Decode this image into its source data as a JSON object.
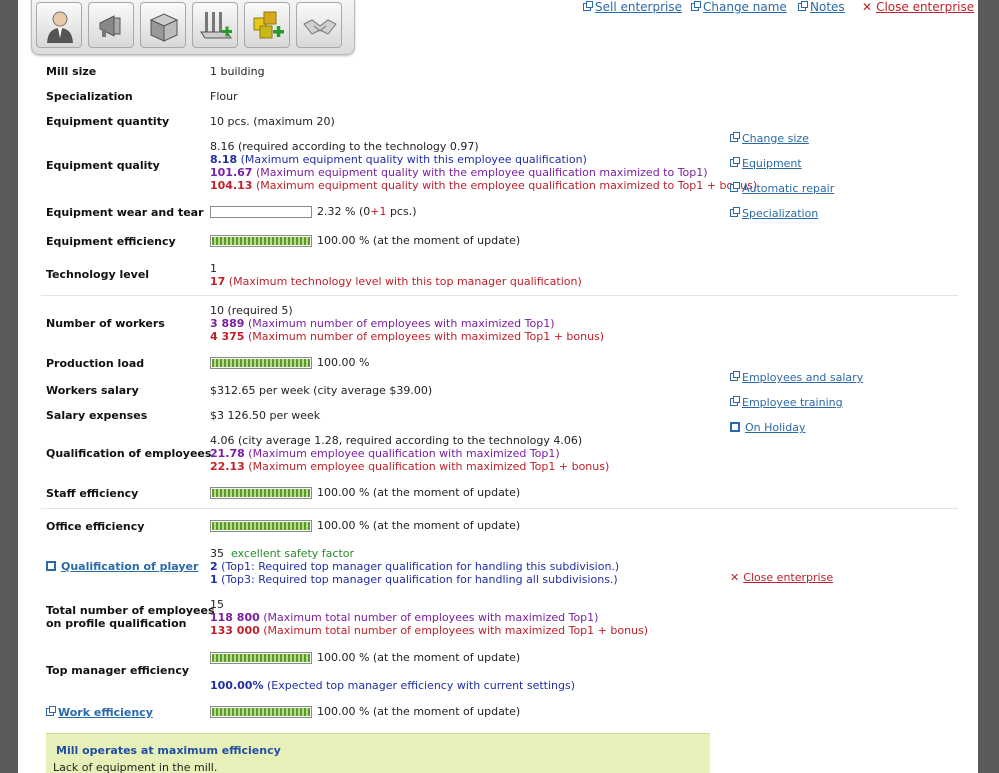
{
  "toolbar": {
    "buttons": [
      {
        "icon": "manager-icon"
      },
      {
        "icon": "megaphone-icon"
      },
      {
        "icon": "box-icon"
      },
      {
        "icon": "production-add-icon"
      },
      {
        "icon": "cubes-add-icon"
      },
      {
        "icon": "handshake-icon"
      }
    ]
  },
  "top_links": {
    "sell": "Sell enterprise",
    "change_name": "Change name",
    "notes": "Notes",
    "close": "Close enterprise"
  },
  "rows": {
    "mill_size": {
      "label": "Mill size",
      "value": "1 building"
    },
    "specialization": {
      "label": "Specialization",
      "value": "Flour"
    },
    "equipment_quantity": {
      "label": "Equipment quantity",
      "value": "10 pcs. (maximum 20)"
    },
    "equipment_quality": {
      "label": "Equipment quality",
      "line1": "8.16 (required according to the technology 0.97)",
      "line2_num": "8.18",
      "line2_text": " (Maximum equipment quality with this employee qualification)",
      "line3_num": "101.67",
      "line3_text": " (Maximum equipment quality with the employee qualification maximized to Top1)",
      "line4_num": "104.13",
      "line4_text": " (Maximum equipment quality with the employee qualification maximized to Top1 + bonus)"
    },
    "wear": {
      "label": "Equipment wear and tear",
      "value_pre": "2.32 % (0",
      "value_plus": "+1",
      "value_post": " pcs.)",
      "percent": 2.32
    },
    "equipment_efficiency": {
      "label": "Equipment efficiency",
      "value": "100.00 % (at the moment of update)",
      "percent": 100
    },
    "technology_level": {
      "label": "Technology level",
      "line1": "1",
      "line2_num": "17",
      "line2_text": " (Maximum technology level with this top manager qualification)"
    },
    "workers": {
      "label": "Number of workers",
      "line1": "10 (required 5)",
      "line2_num": "3 889",
      "line2_text": " (Maximum number of employees with maximized Top1)",
      "line3_num": "4 375",
      "line3_text": " (Maximum number of employees with maximized Top1 + bonus)"
    },
    "production_load": {
      "label": "Production load",
      "value": "100.00 %",
      "percent": 100
    },
    "workers_salary": {
      "label": "Workers salary",
      "value": "$312.65 per week (city average $39.00)"
    },
    "salary_expenses": {
      "label": "Salary expenses",
      "value": "$3 126.50 per week"
    },
    "qualification": {
      "label": "Qualification of employees",
      "line1": "4.06 (city average 1.28, required according to the technology 4.06)",
      "line2_num": "21.78",
      "line2_text": " (Maximum employee qualification with maximized Top1)",
      "line3_num": "22.13",
      "line3_text": " (Maximum employee qualification with maximized Top1 + bonus)"
    },
    "staff_efficiency": {
      "label": "Staff efficiency",
      "value": "100.00 % (at the moment of update)",
      "percent": 100
    },
    "office_efficiency": {
      "label": "Office efficiency",
      "value": "100.00 % (at the moment of update)",
      "percent": 100
    },
    "player_qualification": {
      "label": "Qualification of player",
      "line1_num": "35",
      "line1_text": "excellent safety factor",
      "line2_num": "2",
      "line2_text": " (Top1: Required top manager qualification for handling this subdivision.)",
      "line3_num": "1",
      "line3_text": " (Top3: Required top manager qualification for handling all subdivisions.)"
    },
    "total_employees": {
      "label1": "Total number of employees",
      "label2": "on profile qualification",
      "line1": "15",
      "line2_num": "118 800",
      "line2_text": " (Maximum total number of employees with maximized Top1)",
      "line3_num": "133 000",
      "line3_text": " (Maximum total number of employees with maximized Top1 + bonus)"
    },
    "top_manager_efficiency": {
      "label": "Top manager efficiency",
      "value": "100.00 % (at the moment of update)",
      "percent": 100,
      "expected_num": "100.00%",
      "expected_text": " (Expected top manager efficiency with current settings)"
    },
    "work_efficiency": {
      "label": "Work efficiency",
      "value": "100.00 % (at the moment of update)",
      "percent": 100
    }
  },
  "side_links": {
    "change_size": "Change size",
    "equipment": "Equipment",
    "automatic_repair": "Automatic repair",
    "specialization": "Specialization",
    "employees_salary": "Employees and salary",
    "employee_training": "Employee training",
    "on_holiday": "On Holiday",
    "close_enterprise": "Close enterprise"
  },
  "status": {
    "title": "Mill operates at maximum efficiency",
    "text": "Lack of equipment in the mill."
  },
  "colors": {
    "link": "#2a6aa8",
    "blue": "#1f2fa6",
    "purple": "#7a1fa0",
    "red": "#c0202a",
    "status_bg": "#e7f0b8"
  }
}
